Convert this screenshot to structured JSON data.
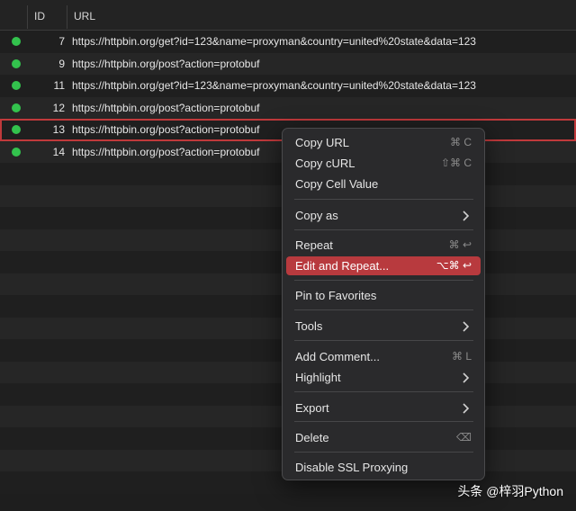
{
  "table": {
    "columns": {
      "id": "ID",
      "url": "URL"
    },
    "rows": [
      {
        "id": "7",
        "url": "https://httpbin.org/get?id=123&name=proxyman&country=united%20state&data=123"
      },
      {
        "id": "9",
        "url": "https://httpbin.org/post?action=protobuf"
      },
      {
        "id": "11",
        "url": "https://httpbin.org/get?id=123&name=proxyman&country=united%20state&data=123"
      },
      {
        "id": "12",
        "url": "https://httpbin.org/post?action=protobuf"
      },
      {
        "id": "13",
        "url": "https://httpbin.org/post?action=protobuf",
        "selected": true
      },
      {
        "id": "14",
        "url": "https://httpbin.org/post?action=protobuf"
      }
    ],
    "status_color": "#33c24d",
    "selection_color": "#c0393b"
  },
  "context_menu": {
    "items": [
      {
        "label": "Copy URL",
        "shortcut": "⌘ C"
      },
      {
        "label": "Copy cURL",
        "shortcut": "⇧⌘ C"
      },
      {
        "label": "Copy Cell Value",
        "shortcut": ""
      },
      {
        "label": "Copy as",
        "submenu": true
      },
      {
        "label": "Repeat",
        "shortcut": "⌘ ↩"
      },
      {
        "label": "Edit and Repeat...",
        "shortcut": "⌥⌘ ↩",
        "highlighted": true
      },
      {
        "label": "Pin to Favorites",
        "shortcut": ""
      },
      {
        "label": "Tools",
        "submenu": true
      },
      {
        "label": "Add Comment...",
        "shortcut": "⌘ L"
      },
      {
        "label": "Highlight",
        "submenu": true
      },
      {
        "label": "Export",
        "submenu": true
      },
      {
        "label": "Delete",
        "shortcut": "⌫"
      },
      {
        "label": "Disable SSL Proxying",
        "shortcut": ""
      }
    ],
    "highlight_color": "#b83a3e"
  },
  "watermark": "头条 @梓羽Python"
}
